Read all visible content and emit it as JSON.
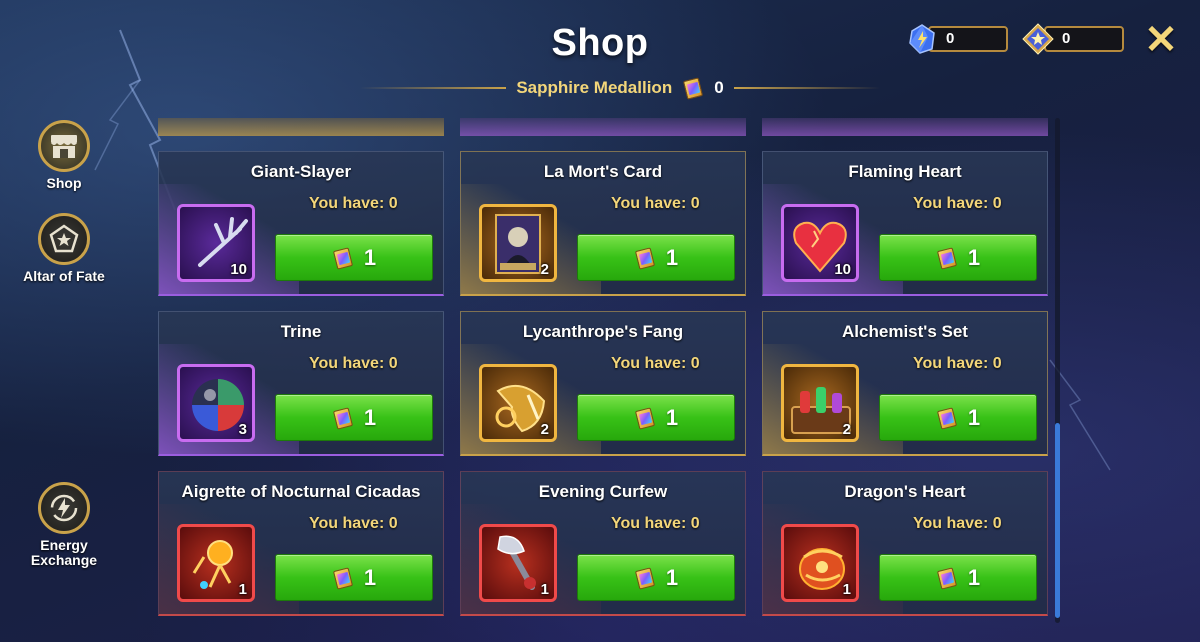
{
  "header": {
    "title": "Shop",
    "currency_name": "Sapphire Medallion",
    "currency_count": "0",
    "close_label": "✕"
  },
  "top_currencies": [
    {
      "icon": "energy-gem-icon",
      "value": "0"
    },
    {
      "icon": "star-emblem-icon",
      "value": "0"
    }
  ],
  "sidebar": {
    "items": [
      {
        "label": "Shop",
        "icon": "shop-icon",
        "active": true
      },
      {
        "label": "Altar of Fate",
        "icon": "pentagon-star-icon",
        "active": false
      },
      {
        "label": "Energy Exchange",
        "icon": "lightning-exchange-icon",
        "active": false
      }
    ]
  },
  "shop": {
    "have_label": "You have: 0",
    "items": [
      {
        "name": "Giant-Slayer",
        "have": "You have: 0",
        "count": "10",
        "price": "1",
        "rarity": "purple",
        "icon": "antler-blade-icon"
      },
      {
        "name": "La Mort's Card",
        "have": "You have: 0",
        "count": "2",
        "price": "1",
        "rarity": "gold",
        "icon": "death-card-icon"
      },
      {
        "name": "Flaming Heart",
        "have": "You have: 0",
        "count": "10",
        "price": "1",
        "rarity": "purple",
        "icon": "flaming-heart-icon"
      },
      {
        "name": "Trine",
        "have": "You have: 0",
        "count": "3",
        "price": "1",
        "rarity": "purple",
        "icon": "tri-orb-icon"
      },
      {
        "name": "Lycanthrope's Fang",
        "have": "You have: 0",
        "count": "2",
        "price": "1",
        "rarity": "gold",
        "icon": "fang-icon"
      },
      {
        "name": "Alchemist's Set",
        "have": "You have: 0",
        "count": "2",
        "price": "1",
        "rarity": "gold",
        "icon": "potion-set-icon"
      },
      {
        "name": "Aigrette of Nocturnal Cicadas",
        "have": "You have: 0",
        "count": "1",
        "price": "1",
        "rarity": "red",
        "icon": "aigrette-icon"
      },
      {
        "name": "Evening Curfew",
        "have": "You have: 0",
        "count": "1",
        "price": "1",
        "rarity": "red",
        "icon": "curfew-axe-icon"
      },
      {
        "name": "Dragon's Heart",
        "have": "You have: 0",
        "count": "1",
        "price": "1",
        "rarity": "red",
        "icon": "dragon-heart-icon"
      }
    ]
  },
  "colors": {
    "gold": "#c9a24a",
    "purple": "#9b5ee0",
    "red": "#c34a4a",
    "buy_green": "#38c217",
    "accent_text": "#f3d67a"
  }
}
